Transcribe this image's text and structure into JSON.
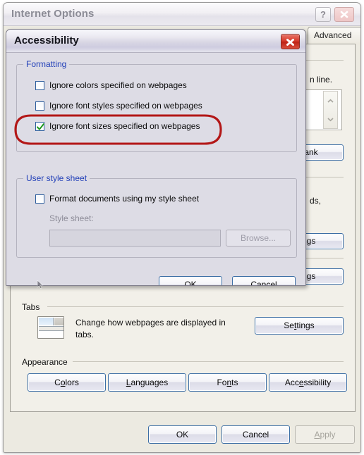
{
  "background_window": {
    "title": "Internet Options",
    "help_button": "?",
    "close_button": "close-icon",
    "tabs": [
      {
        "label": "Advanced",
        "selected": false
      }
    ],
    "partial_texts": {
      "home_line": "n line.",
      "home_prefix": "n",
      "blank_button": "ank",
      "history_text": "ds,",
      "settings_partial_1": "gs",
      "settings_partial_2": "gs"
    },
    "tabs_section": {
      "legend": "Tabs",
      "description_line1": "Change how webpages are displayed in",
      "description_line2": "tabs.",
      "settings_button": {
        "prefix": "Se",
        "accel": "t",
        "suffix": "tings"
      }
    },
    "appearance_section": {
      "legend": "Appearance",
      "buttons": [
        {
          "prefix": "C",
          "accel": "o",
          "suffix": "lors"
        },
        {
          "prefix": "",
          "accel": "L",
          "suffix": "anguages"
        },
        {
          "prefix": "Fo",
          "accel": "n",
          "suffix": "ts"
        },
        {
          "prefix": "Acc",
          "accel": "e",
          "suffix": "ssibility"
        }
      ]
    },
    "footer_buttons": [
      {
        "prefix": "",
        "accel": "",
        "suffix": "OK",
        "enabled": true
      },
      {
        "prefix": "",
        "accel": "",
        "suffix": "Cancel",
        "enabled": true
      },
      {
        "prefix": "",
        "accel": "A",
        "suffix": "pply",
        "enabled": false
      }
    ]
  },
  "accessibility_dialog": {
    "title": "Accessibility",
    "close_button": "close-icon",
    "formatting_group": {
      "legend": "Formatting",
      "checkboxes": [
        {
          "label": "Ignore colors specified on webpages",
          "checked": false
        },
        {
          "label": "Ignore font styles specified on webpages",
          "checked": false
        },
        {
          "label": "Ignore font sizes specified on webpages",
          "checked": true
        }
      ]
    },
    "user_style_sheet_group": {
      "legend": "User style sheet",
      "checkbox": {
        "label": "Format documents using my style sheet",
        "checked": false
      },
      "field_label": "Style sheet:",
      "field_value": "",
      "browse_button": "Browse...",
      "browse_enabled": false
    },
    "footer_buttons": [
      {
        "label": "OK",
        "enabled": true
      },
      {
        "label": "Cancel",
        "enabled": true
      }
    ]
  },
  "annotation": {
    "shape": "red-ellipse-highlight",
    "color": "#b31717",
    "targets": "Ignore font sizes specified on webpages"
  },
  "colors": {
    "dialog_background": "#dddce5",
    "window_background": "#eceae1",
    "panel_background": "#f2f0e9",
    "legend_text": "#2240b8",
    "button_border": "#3c6ea5",
    "checkbox_check": "#1f9a1f",
    "annotation_red": "#b31717",
    "close_red": "#cc2b1a"
  }
}
